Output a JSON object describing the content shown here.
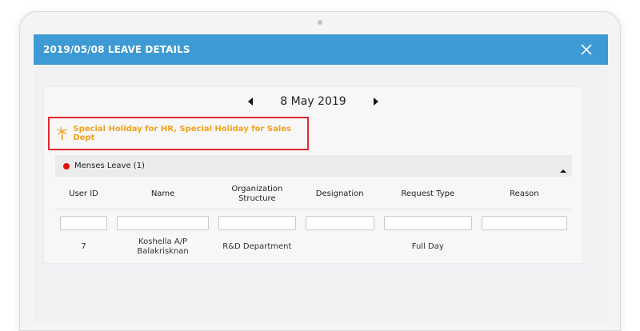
{
  "modal": {
    "title": "2019/05/08 LEAVE DETAILS"
  },
  "date_nav": {
    "date": "8 May 2019"
  },
  "holiday": {
    "text": "Special Holiday for HR, Special Holiday for Sales Dept",
    "color": "#f0a21f"
  },
  "leave_group": {
    "label": "Menses Leave (1)",
    "dot_color": "#e10e0e"
  },
  "table": {
    "headers": [
      "User ID",
      "Name",
      "Organization Structure",
      "Designation",
      "Request Type",
      "Reason"
    ],
    "rows": [
      {
        "user_id": "7",
        "name": "Koshella A/P Balakrisknan",
        "org": "R&D Department",
        "designation": "",
        "request_type": "Full Day",
        "reason": ""
      }
    ]
  },
  "colors": {
    "header_blue": "#3d9ad5",
    "highlight_red": "#e3262f"
  },
  "icons": {
    "close": "close-icon",
    "prev": "caret-left-icon",
    "next": "caret-right-icon",
    "palm": "palm-tree-icon",
    "collapse": "caret-up-icon"
  }
}
